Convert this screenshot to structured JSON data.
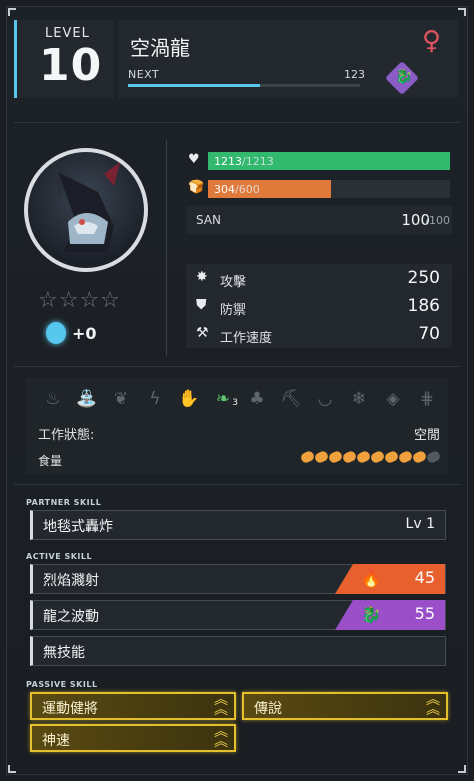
{
  "header": {
    "level_label": "LEVEL",
    "level_value": "10",
    "pal_name": "空渦龍",
    "gender_symbol": "♀",
    "next_label": "NEXT",
    "next_value": "123",
    "exp_progress": 0.57,
    "element_icon": "dragon-element-icon",
    "element_color": "#8a5cc6"
  },
  "portrait": {
    "rank_stars": 0,
    "max_stars": 4,
    "star_glyphs": "☆☆☆☆",
    "soul_value": "+0"
  },
  "vitals": {
    "hp_current": "1213",
    "hp_max": "/1213",
    "hp_fraction": 1.0,
    "hp_color": "#32b96e",
    "hunger_current": "304",
    "hunger_max": "/600",
    "hunger_fraction": 0.5067,
    "hunger_color": "#e07a3a",
    "san_label": "SAN",
    "san_value": "100",
    "san_max": "/100"
  },
  "attributes": [
    {
      "icon": "attack-icon",
      "label": "攻擊",
      "value": "250"
    },
    {
      "icon": "defense-icon",
      "label": "防禦",
      "value": "186"
    },
    {
      "icon": "work-speed-icon",
      "label": "工作速度",
      "value": "70"
    }
  ],
  "work": {
    "icons": [
      {
        "name": "kindling-icon",
        "active": false
      },
      {
        "name": "watering-icon",
        "active": false
      },
      {
        "name": "planting-icon",
        "active": false
      },
      {
        "name": "electricity-icon",
        "active": false
      },
      {
        "name": "handiwork-icon",
        "active": false
      },
      {
        "name": "gathering-icon",
        "active": true,
        "level": "3"
      },
      {
        "name": "lumbering-icon",
        "active": false
      },
      {
        "name": "mining-icon",
        "active": false
      },
      {
        "name": "medicine-icon",
        "active": false
      },
      {
        "name": "cooling-icon",
        "active": false
      },
      {
        "name": "transporting-icon",
        "active": false
      },
      {
        "name": "farming-icon",
        "active": false
      }
    ],
    "status_label": "工作狀態:",
    "status_value": "空閒",
    "food_label": "食量",
    "food_filled": 9,
    "food_total": 10
  },
  "skills": {
    "partner_label": "PARTNER SKILL",
    "partner": {
      "name": "地毯式轟炸",
      "level": "Lv 1"
    },
    "active_label": "ACTIVE SKILL",
    "active": [
      {
        "name": "烈焰濺射",
        "element": "fire-icon",
        "color": "#e8602e",
        "power": "45"
      },
      {
        "name": "龍之波動",
        "element": "dragon-icon",
        "color": "#9a4fc9",
        "power": "55"
      },
      {
        "name": "無技能",
        "element": "",
        "color": "",
        "power": ""
      }
    ],
    "passive_label": "PASSIVE SKILL",
    "passive": [
      {
        "name": "運動健將",
        "rank_icon": "rank-up-icon"
      },
      {
        "name": "傳說",
        "rank_icon": "rank-up-icon"
      },
      {
        "name": "神速",
        "rank_icon": "rank-up-icon"
      }
    ]
  }
}
